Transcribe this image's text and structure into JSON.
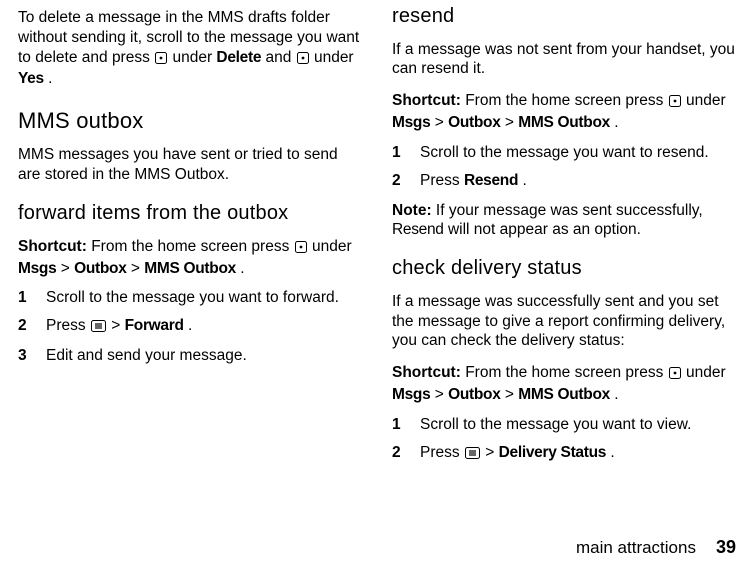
{
  "left": {
    "p1_a": "To delete a message in the MMS drafts folder without sending it, scroll to the message you want to delete and press ",
    "p1_b": " under ",
    "p1_delete": "Delete",
    "p1_c": " and ",
    "p1_d": " under ",
    "p1_yes": "Yes",
    "p1_e": ".",
    "h2": "MMS outbox",
    "p2": "MMS messages you have sent or tried to send are stored in the MMS Outbox.",
    "h3": "forward items from the outbox",
    "shortcut_label": "Shortcut:",
    "shortcut_a": " From the home screen press ",
    "shortcut_b": " under ",
    "msgs": "Msgs",
    "gt": " > ",
    "outbox": "Outbox",
    "mms_outbox": "MMS Outbox",
    "dot": ".",
    "step1_num": "1",
    "step1": "Scroll to the message you want to forward.",
    "step2_num": "2",
    "step2_a": "Press ",
    "step2_b": " > ",
    "forward": "Forward",
    "step3_num": "3",
    "step3": "Edit and send your message."
  },
  "right": {
    "h3a": "resend",
    "p1": "If a message was not sent from your handset, you can resend it.",
    "shortcut_label": "Shortcut:",
    "shortcut_a": " From the home screen press ",
    "shortcut_b": " under ",
    "msgs": "Msgs",
    "gt": " > ",
    "outbox": "Outbox",
    "mms_outbox": "MMS Outbox",
    "dot": ".",
    "step1_num": "1",
    "step1": "Scroll to the message you want to resend.",
    "step2_num": "2",
    "step2_a": "Press ",
    "resend": "Resend",
    "note_label": "Note:",
    "note_a": " If your message was sent successfully, ",
    "note_b": " will not appear as an option.",
    "h3b": "check delivery status",
    "p3": "If a message was successfully sent and you set the message to give a report confirming delivery, you can check the delivery status:",
    "stepB1_num": "1",
    "stepB1": "Scroll to the message you want to view.",
    "stepB2_num": "2",
    "stepB2_a": "Press ",
    "stepB2_b": " > ",
    "delivery": "Delivery Status"
  },
  "footer": {
    "text": "main attractions",
    "page": "39"
  }
}
